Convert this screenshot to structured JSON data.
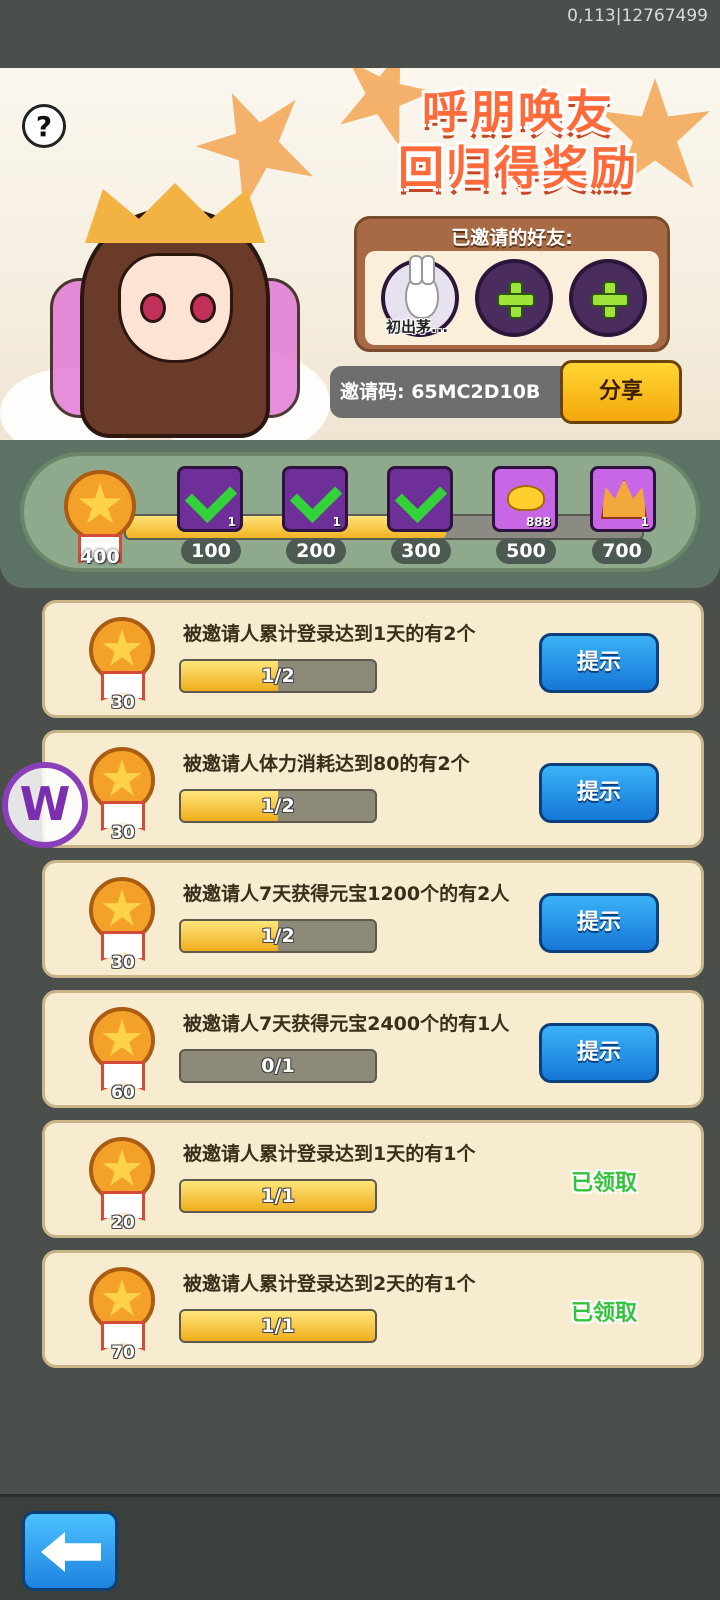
{
  "status": {
    "id_text": "0,113|12767499"
  },
  "banner": {
    "title_line1": "呼朋唤友",
    "title_line2": "回归得奖励",
    "help_icon": "?",
    "invited_title": "已邀请的好友:",
    "friends": [
      {
        "name": "初出茅...",
        "filled": true
      },
      {
        "name": "",
        "filled": false
      },
      {
        "name": "",
        "filled": false
      }
    ],
    "invite_code": "邀请码: 65MC2D10B",
    "share_label": "分享"
  },
  "track": {
    "total": "400",
    "progress_percent": 62,
    "milestones": [
      {
        "label": "100",
        "claimed": true,
        "qty": "1"
      },
      {
        "label": "200",
        "claimed": true,
        "qty": "1"
      },
      {
        "label": "300",
        "claimed": true,
        "qty": ""
      },
      {
        "label": "500",
        "claimed": false,
        "qty": "888"
      },
      {
        "label": "700",
        "claimed": false,
        "qty": "1"
      }
    ]
  },
  "tasks": [
    {
      "text": "被邀请人累计登录达到1天的有2个",
      "reward": "30",
      "progress": "1/2",
      "fill": 0.5,
      "action": "提示"
    },
    {
      "text": "被邀请人体力消耗达到80的有2个",
      "reward": "30",
      "progress": "1/2",
      "fill": 0.5,
      "action": "提示"
    },
    {
      "text": "被邀请人7天获得元宝1200个的有2人",
      "reward": "30",
      "progress": "1/2",
      "fill": 0.5,
      "action": "提示"
    },
    {
      "text": "被邀请人7天获得元宝2400个的有1人",
      "reward": "60",
      "progress": "0/1",
      "fill": 0,
      "action": "提示"
    },
    {
      "text": "被邀请人累计登录达到1天的有1个",
      "reward": "20",
      "progress": "1/1",
      "fill": 1,
      "action": "已领取"
    },
    {
      "text": "被邀请人累计登录达到2天的有1个",
      "reward": "70",
      "progress": "1/1",
      "fill": 1,
      "action": "已领取"
    }
  ],
  "overlay_logo": "W"
}
